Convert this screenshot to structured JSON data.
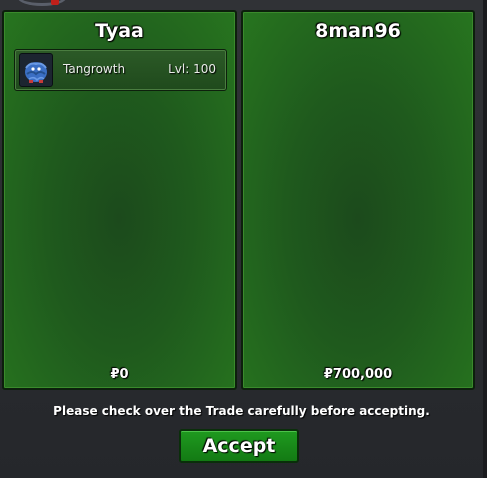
{
  "trade": {
    "left": {
      "trader_name": "Tyaa",
      "offer": [
        {
          "name": "Tangrowth",
          "level": "Lvl: 100",
          "icon": "tangrowth-sprite-icon"
        }
      ],
      "money": "₽0"
    },
    "right": {
      "trader_name": "8man96",
      "money": "₽700,000"
    },
    "notice": "Please check over the Trade carefully before accepting.",
    "accept_label": "Accept"
  },
  "colors": {
    "panel_green": "#27751f",
    "button_green": "#1f9a1f",
    "window_bg": "#2a2c30"
  }
}
